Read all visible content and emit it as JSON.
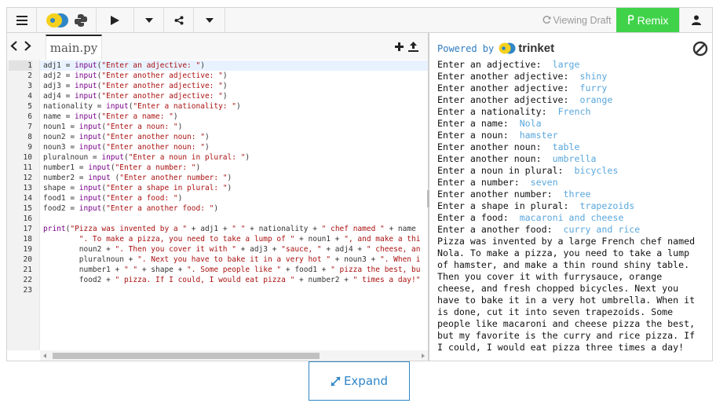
{
  "toolbar": {
    "menu_icon": "hamburger-menu-icon",
    "language_icons": [
      "trinket-logo-icon",
      "python-logo-icon"
    ],
    "run_icon": "play-icon",
    "share_icon": "share-icon",
    "draft_label": "Viewing Draft",
    "remix_label": "Remix",
    "user_icon": "user-icon",
    "colors": {
      "remix_bg": "#40d34a",
      "link": "#2d7bc0"
    }
  },
  "editor": {
    "file_tab": "main.py",
    "lines": [
      {
        "n": "1",
        "parts": [
          [
            "o",
            "adj1 = "
          ],
          [
            "b",
            "input"
          ],
          [
            "o",
            "("
          ],
          [
            "s",
            "\"Enter an adjective: \""
          ],
          [
            "o",
            ")"
          ]
        ]
      },
      {
        "n": "2",
        "parts": [
          [
            "o",
            "adj2 = "
          ],
          [
            "b",
            "input"
          ],
          [
            "o",
            "("
          ],
          [
            "s",
            "\"Enter another adjective: \""
          ],
          [
            "o",
            ")"
          ]
        ]
      },
      {
        "n": "3",
        "parts": [
          [
            "o",
            "adj3 = "
          ],
          [
            "b",
            "input"
          ],
          [
            "o",
            "("
          ],
          [
            "s",
            "\"Enter another adjective: \""
          ],
          [
            "o",
            ")"
          ]
        ]
      },
      {
        "n": "4",
        "parts": [
          [
            "o",
            "adj4 = "
          ],
          [
            "b",
            "input"
          ],
          [
            "o",
            "("
          ],
          [
            "s",
            "\"Enter another adjective: \""
          ],
          [
            "o",
            ")"
          ]
        ]
      },
      {
        "n": "5",
        "parts": [
          [
            "o",
            "nationality = "
          ],
          [
            "b",
            "input"
          ],
          [
            "o",
            "("
          ],
          [
            "s",
            "\"Enter a nationality: \""
          ],
          [
            "o",
            ")"
          ]
        ]
      },
      {
        "n": "6",
        "parts": [
          [
            "o",
            "name = "
          ],
          [
            "b",
            "input"
          ],
          [
            "o",
            "("
          ],
          [
            "s",
            "\"Enter a name: \""
          ],
          [
            "o",
            ")"
          ]
        ]
      },
      {
        "n": "7",
        "parts": [
          [
            "o",
            "noun1 = "
          ],
          [
            "b",
            "input"
          ],
          [
            "o",
            "("
          ],
          [
            "s",
            "\"Enter a noun: \""
          ],
          [
            "o",
            ")"
          ]
        ]
      },
      {
        "n": "8",
        "parts": [
          [
            "o",
            "noun2 = "
          ],
          [
            "b",
            "input"
          ],
          [
            "o",
            "("
          ],
          [
            "s",
            "\"Enter another noun: \""
          ],
          [
            "o",
            ")"
          ]
        ]
      },
      {
        "n": "9",
        "parts": [
          [
            "o",
            "noun3 = "
          ],
          [
            "b",
            "input"
          ],
          [
            "o",
            "("
          ],
          [
            "s",
            "\"Enter another noun: \""
          ],
          [
            "o",
            ")"
          ]
        ]
      },
      {
        "n": "10",
        "parts": [
          [
            "o",
            "pluralnoun = "
          ],
          [
            "b",
            "input"
          ],
          [
            "o",
            "("
          ],
          [
            "s",
            "\"Enter a noun in plural: \""
          ],
          [
            "o",
            ")"
          ]
        ]
      },
      {
        "n": "11",
        "parts": [
          [
            "o",
            "number1 = "
          ],
          [
            "b",
            "input"
          ],
          [
            "o",
            "("
          ],
          [
            "s",
            "\"Enter a number: \""
          ],
          [
            "o",
            ")"
          ]
        ]
      },
      {
        "n": "12",
        "parts": [
          [
            "o",
            "number2 = "
          ],
          [
            "b",
            "input"
          ],
          [
            "o",
            " ("
          ],
          [
            "s",
            "\"Enter another number: \""
          ],
          [
            "o",
            ")"
          ]
        ]
      },
      {
        "n": "13",
        "parts": [
          [
            "o",
            "shape = "
          ],
          [
            "b",
            "input"
          ],
          [
            "o",
            "("
          ],
          [
            "s",
            "\"Enter a shape in plural: \""
          ],
          [
            "o",
            ")"
          ]
        ]
      },
      {
        "n": "14",
        "parts": [
          [
            "o",
            "food1 = "
          ],
          [
            "b",
            "input"
          ],
          [
            "o",
            "("
          ],
          [
            "s",
            "\"Enter a food: \""
          ],
          [
            "o",
            ")"
          ]
        ]
      },
      {
        "n": "15",
        "parts": [
          [
            "o",
            "food2 = "
          ],
          [
            "b",
            "input"
          ],
          [
            "o",
            "("
          ],
          [
            "s",
            "\"Enter a another food: \""
          ],
          [
            "o",
            ")"
          ]
        ]
      },
      {
        "n": "16",
        "parts": []
      },
      {
        "n": "17",
        "parts": [
          [
            "b",
            "print"
          ],
          [
            "o",
            "("
          ],
          [
            "s",
            "\"Pizza was invented by a \""
          ],
          [
            "o",
            " + adj1 + "
          ],
          [
            "s",
            "\" \""
          ],
          [
            "o",
            " + nationality + "
          ],
          [
            "s",
            "\" chef named \""
          ],
          [
            "o",
            " + name"
          ]
        ]
      },
      {
        "n": "18",
        "parts": [
          [
            "o",
            "        "
          ],
          [
            "s",
            "\". To make a pizza, you need to take a lump of \""
          ],
          [
            "o",
            " + noun1 + "
          ],
          [
            "s",
            "\", and make a thi"
          ]
        ]
      },
      {
        "n": "19",
        "parts": [
          [
            "o",
            "        noun2 + "
          ],
          [
            "s",
            "\". Then you cover it with \""
          ],
          [
            "o",
            " + adj3 + "
          ],
          [
            "s",
            "\"sauce, \""
          ],
          [
            "o",
            " + adj4 + "
          ],
          [
            "s",
            "\" cheese, an"
          ]
        ]
      },
      {
        "n": "20",
        "parts": [
          [
            "o",
            "        pluralnoun + "
          ],
          [
            "s",
            "\". Next you have to bake it in a very hot \""
          ],
          [
            "o",
            " + noun3 + "
          ],
          [
            "s",
            "\". When i"
          ]
        ]
      },
      {
        "n": "21",
        "parts": [
          [
            "o",
            "        number1 + "
          ],
          [
            "s",
            "\" \""
          ],
          [
            "o",
            " + shape + "
          ],
          [
            "s",
            "\". Some people like \""
          ],
          [
            "o",
            " + food1 + "
          ],
          [
            "s",
            "\" pizza the best, bu"
          ]
        ]
      },
      {
        "n": "22",
        "parts": [
          [
            "o",
            "        food2 + "
          ],
          [
            "s",
            "\" pizza. If I could, I would eat pizza \""
          ],
          [
            "o",
            " + number2 + "
          ],
          [
            "s",
            "\" times a day!\""
          ]
        ]
      },
      {
        "n": "23",
        "parts": []
      }
    ]
  },
  "output": {
    "powered_by": "Powered by",
    "brand": "trinket",
    "stop_icon": "stop-icon",
    "prompts": [
      {
        "prompt": "Enter an adjective:  ",
        "answer": "large"
      },
      {
        "prompt": "Enter another adjective:  ",
        "answer": "shiny"
      },
      {
        "prompt": "Enter another adjective:  ",
        "answer": "furry"
      },
      {
        "prompt": "Enter another adjective:  ",
        "answer": "orange"
      },
      {
        "prompt": "Enter a nationality:  ",
        "answer": "French"
      },
      {
        "prompt": "Enter a name:  ",
        "answer": "Nola"
      },
      {
        "prompt": "Enter a noun:  ",
        "answer": "hamster"
      },
      {
        "prompt": "Enter another noun:  ",
        "answer": "table"
      },
      {
        "prompt": "Enter another noun:  ",
        "answer": "umbrella"
      },
      {
        "prompt": "Enter a noun in plural:  ",
        "answer": "bicycles"
      },
      {
        "prompt": "Enter a number:  ",
        "answer": "seven"
      },
      {
        "prompt": "Enter another number:  ",
        "answer": "three"
      },
      {
        "prompt": "Enter a shape in plural:  ",
        "answer": "trapezoids"
      },
      {
        "prompt": "Enter a food:  ",
        "answer": "macaroni and cheese"
      },
      {
        "prompt": "Enter a another food:  ",
        "answer": "curry and rice"
      }
    ],
    "story_lines": [
      "Pizza was invented by a large French chef named",
      "Nola. To make a pizza, you need to take a lump",
      "of hamster, and make a thin round shiny table.",
      "Then you cover it with furrysauce, orange",
      "cheese, and fresh chopped bicycles. Next you",
      "have to bake it in a very hot umbrella. When it",
      "is done, cut it into seven trapezoids. Some",
      "people like macaroni and cheese pizza the best,",
      "but my favorite is the curry and rice pizza. If",
      "I could, I would eat pizza three times a day!"
    ],
    "colors": {
      "user_input": "#5aa7dd"
    }
  },
  "expand": {
    "label": "Expand"
  }
}
